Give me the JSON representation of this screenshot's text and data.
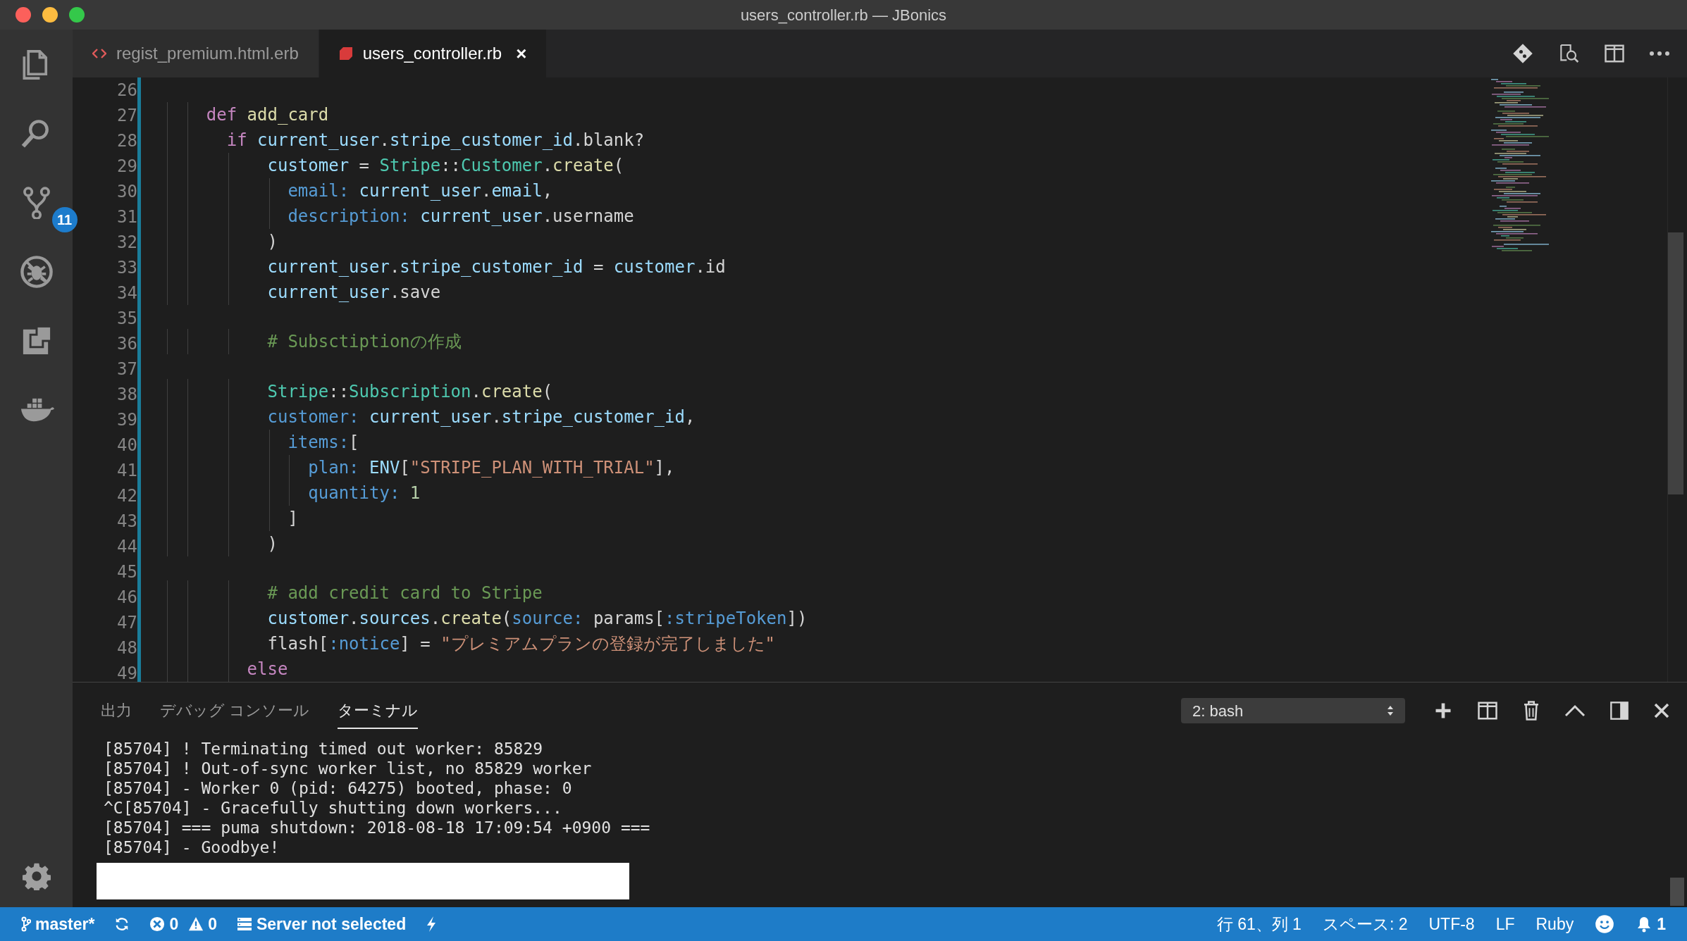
{
  "window": {
    "title": "users_controller.rb — JBonics"
  },
  "activity_bar": [
    {
      "kind": "explorer"
    },
    {
      "kind": "search"
    },
    {
      "kind": "source-control",
      "badge": "11"
    },
    {
      "kind": "debug"
    },
    {
      "kind": "extensions"
    },
    {
      "kind": "docker"
    }
  ],
  "tabs": [
    {
      "label": "regist_premium.html.erb",
      "kind": "erb",
      "selected": false
    },
    {
      "label": "users_controller.rb",
      "kind": "ruby",
      "selected": true,
      "close": "×"
    }
  ],
  "editor": {
    "lines": [
      {
        "number": "26"
      },
      {
        "number": "27",
        "tokens": [
          {
            "kind": "keyword",
            "text": "    def"
          },
          {
            "kind": "function",
            "text": " add_card"
          }
        ]
      },
      {
        "number": "28",
        "tokens": [
          {
            "kind": "keyword",
            "text": "      if"
          },
          {
            "kind": "variable",
            "text": " current_user"
          },
          {
            "kind": "plain",
            "text": "."
          },
          {
            "kind": "variable",
            "text": "stripe_customer_id"
          },
          {
            "kind": "plain",
            "text": ".blank?"
          }
        ]
      },
      {
        "number": "29",
        "tokens": [
          {
            "kind": "variable",
            "text": "          customer"
          },
          {
            "kind": "plain",
            "text": " = "
          },
          {
            "kind": "constant",
            "text": "Stripe"
          },
          {
            "kind": "plain",
            "text": "::"
          },
          {
            "kind": "constant",
            "text": "Customer"
          },
          {
            "kind": "plain",
            "text": "."
          },
          {
            "kind": "function",
            "text": "create"
          },
          {
            "kind": "plain",
            "text": "("
          }
        ]
      },
      {
        "number": "30",
        "tokens": [
          {
            "kind": "key",
            "text": "            email:"
          },
          {
            "kind": "variable",
            "text": " current_user"
          },
          {
            "kind": "plain",
            "text": "."
          },
          {
            "kind": "variable",
            "text": "email"
          },
          {
            "kind": "plain",
            "text": ","
          }
        ]
      },
      {
        "number": "31",
        "tokens": [
          {
            "kind": "key",
            "text": "            description:"
          },
          {
            "kind": "variable",
            "text": " current_user"
          },
          {
            "kind": "plain",
            "text": ".username"
          }
        ]
      },
      {
        "number": "32",
        "tokens": [
          {
            "kind": "plain",
            "text": "          )"
          }
        ]
      },
      {
        "number": "33",
        "tokens": [
          {
            "kind": "variable",
            "text": "          current_user"
          },
          {
            "kind": "plain",
            "text": "."
          },
          {
            "kind": "variable",
            "text": "stripe_customer_id"
          },
          {
            "kind": "plain",
            "text": " = "
          },
          {
            "kind": "variable",
            "text": "customer"
          },
          {
            "kind": "plain",
            "text": ".id"
          }
        ]
      },
      {
        "number": "34",
        "tokens": [
          {
            "kind": "variable",
            "text": "          current_user"
          },
          {
            "kind": "plain",
            "text": ".save"
          }
        ]
      },
      {
        "number": "35"
      },
      {
        "number": "36",
        "tokens": [
          {
            "kind": "comment",
            "text": "          # Subsctiptionの作成"
          }
        ]
      },
      {
        "number": "37"
      },
      {
        "number": "38",
        "tokens": [
          {
            "kind": "constant",
            "text": "          Stripe"
          },
          {
            "kind": "plain",
            "text": "::"
          },
          {
            "kind": "constant",
            "text": "Subscription"
          },
          {
            "kind": "plain",
            "text": "."
          },
          {
            "kind": "function",
            "text": "create"
          },
          {
            "kind": "plain",
            "text": "("
          }
        ]
      },
      {
        "number": "39",
        "tokens": [
          {
            "kind": "key",
            "text": "          customer:"
          },
          {
            "kind": "variable",
            "text": " current_user"
          },
          {
            "kind": "plain",
            "text": "."
          },
          {
            "kind": "variable",
            "text": "stripe_customer_id"
          },
          {
            "kind": "plain",
            "text": ","
          }
        ]
      },
      {
        "number": "40",
        "tokens": [
          {
            "kind": "key",
            "text": "            items:"
          },
          {
            "kind": "plain",
            "text": "["
          }
        ]
      },
      {
        "number": "41",
        "tokens": [
          {
            "kind": "key",
            "text": "              plan:"
          },
          {
            "kind": "variable",
            "text": " ENV"
          },
          {
            "kind": "plain",
            "text": "["
          },
          {
            "kind": "string",
            "text": "\"STRIPE_PLAN_WITH_TRIAL\""
          },
          {
            "kind": "plain",
            "text": "],"
          }
        ]
      },
      {
        "number": "42",
        "tokens": [
          {
            "kind": "key",
            "text": "              quantity:"
          },
          {
            "kind": "number",
            "text": " 1"
          }
        ]
      },
      {
        "number": "43",
        "tokens": [
          {
            "kind": "plain",
            "text": "            ]"
          }
        ]
      },
      {
        "number": "44",
        "tokens": [
          {
            "kind": "plain",
            "text": "          )"
          }
        ]
      },
      {
        "number": "45"
      },
      {
        "number": "46",
        "tokens": [
          {
            "kind": "comment",
            "text": "          # add credit card to Stripe"
          }
        ]
      },
      {
        "number": "47",
        "tokens": [
          {
            "kind": "variable",
            "text": "          customer"
          },
          {
            "kind": "plain",
            "text": "."
          },
          {
            "kind": "variable",
            "text": "sources"
          },
          {
            "kind": "plain",
            "text": "."
          },
          {
            "kind": "function",
            "text": "create"
          },
          {
            "kind": "plain",
            "text": "("
          },
          {
            "kind": "key",
            "text": "source:"
          },
          {
            "kind": "plain",
            "text": " params["
          },
          {
            "kind": "key",
            "text": ":stripeToken"
          },
          {
            "kind": "plain",
            "text": "])"
          }
        ]
      },
      {
        "number": "48",
        "tokens": [
          {
            "kind": "plain",
            "text": "          flash["
          },
          {
            "kind": "key",
            "text": ":notice"
          },
          {
            "kind": "plain",
            "text": "] = "
          },
          {
            "kind": "string",
            "text": "\"プレミアムプランの登録が完了しました\""
          }
        ]
      },
      {
        "number": "49",
        "tokens": [
          {
            "kind": "keyword",
            "text": "        else"
          }
        ]
      }
    ]
  },
  "panel": {
    "tabs": [
      {
        "label": "出力",
        "selected": false
      },
      {
        "label": "デバッグ コンソール",
        "selected": false
      },
      {
        "label": "ターミナル",
        "selected": true
      }
    ],
    "terminal_select": "2: bash",
    "terminal_lines": [
      "[85704] ! Terminating timed out worker: 85829",
      "[85704] ! Out-of-sync worker list, no 85829 worker",
      "[85704] - Worker 0 (pid: 64275) booted, phase: 0",
      "^C[85704] - Gracefully shutting down workers...",
      "[85704] === puma shutdown: 2018-08-18 17:09:54 +0900 ===",
      "[85704] - Goodbye!"
    ]
  },
  "status_bar": {
    "branch": "master*",
    "errors": "0",
    "warnings": "0",
    "server": "Server not selected",
    "position": "行 61、列 1",
    "indent": "スペース: 2",
    "encoding": "UTF-8",
    "eol": "LF",
    "language": "Ruby",
    "notifications": "1"
  }
}
